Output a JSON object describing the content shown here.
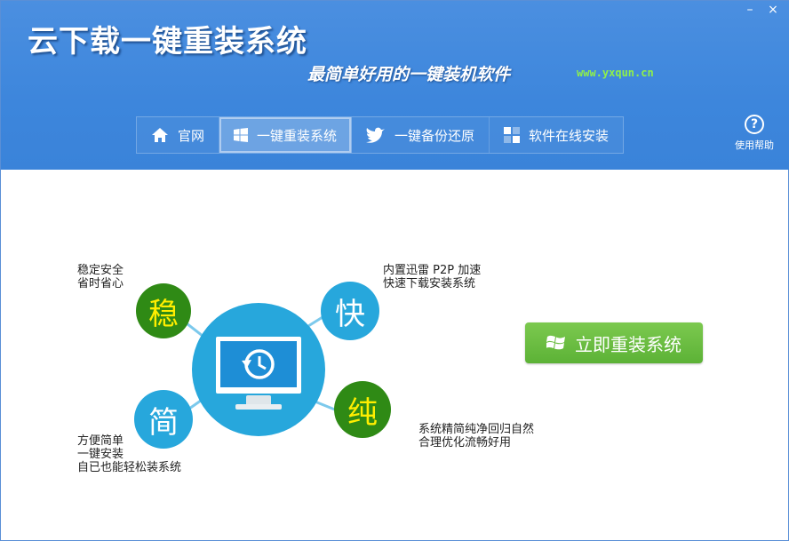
{
  "window": {
    "title": "云下载一键重装系统",
    "tagline": "最简单好用的一键装机软件",
    "url": "www.yxqun.cn",
    "minimize": "–",
    "close": "×"
  },
  "nav": {
    "items": [
      {
        "label": "官网",
        "icon": "home-icon"
      },
      {
        "label": "一键重装系统",
        "icon": "windows-icon",
        "active": true
      },
      {
        "label": "一键备份还原",
        "icon": "bird-icon"
      },
      {
        "label": "软件在线安装",
        "icon": "blocks-icon"
      }
    ]
  },
  "help": {
    "label": "使用帮助",
    "glyph": "?"
  },
  "features": {
    "stable": {
      "badge": "稳",
      "line1": "稳定安全",
      "line2": "省时省心"
    },
    "fast": {
      "badge": "快",
      "line1": "内置迅雷 P2P 加速",
      "line2": "快速下载安装系统"
    },
    "simple": {
      "badge": "简",
      "line1": "方便简单",
      "line2": "一键安装",
      "line3": "自已也能轻松装系统"
    },
    "pure": {
      "badge": "纯",
      "line1": "系统精简纯净回归自然",
      "line2": "合理优化流畅好用"
    }
  },
  "install_button": {
    "label": "立即重装系统"
  },
  "colors": {
    "header": "#3d86dc",
    "badge_green": "#2f8a15",
    "badge_blue": "#27a7dc",
    "badge_yellow_text": "#ffee00",
    "button_green": "#6cbd42"
  }
}
